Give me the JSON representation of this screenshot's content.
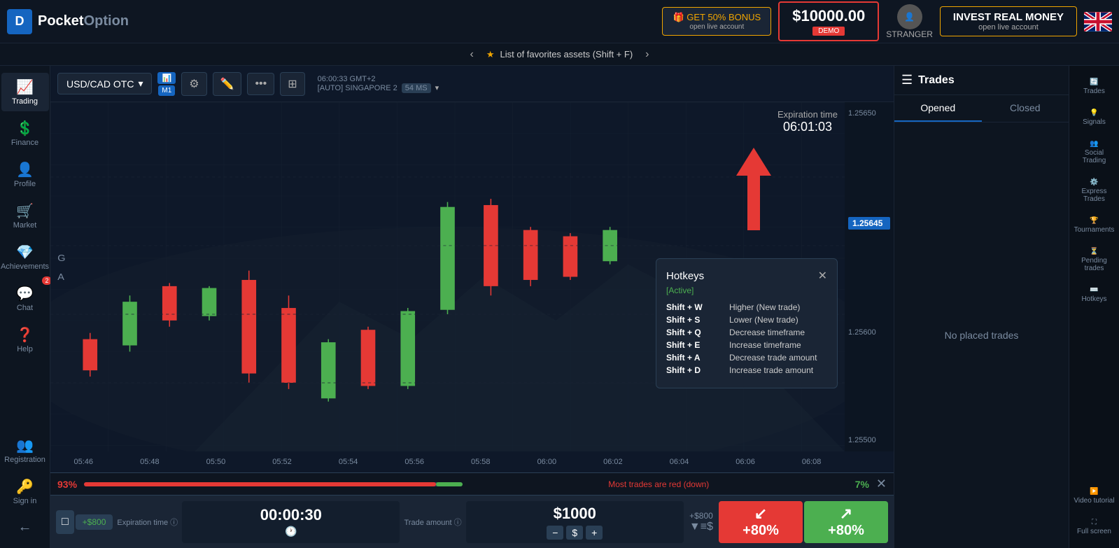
{
  "header": {
    "logo_text": "Pocket",
    "logo_text2": "Option",
    "bonus_label": "GET 50% BONUS",
    "bonus_sub": "open live account",
    "balance": "$10000.00",
    "balance_mode": "DEMO",
    "user_label": "STRANGER",
    "invest_title": "INVEST REAL MONEY",
    "invest_sub": "open live account"
  },
  "fav_bar": {
    "text": "List of favorites assets (Shift + F)"
  },
  "left_sidebar": {
    "items": [
      {
        "label": "Trading",
        "icon": "📈"
      },
      {
        "label": "Finance",
        "icon": "💲"
      },
      {
        "label": "Profile",
        "icon": "👤"
      },
      {
        "label": "Market",
        "icon": "🛒"
      },
      {
        "label": "Achievements",
        "icon": "💎"
      },
      {
        "label": "Chat",
        "icon": "💬",
        "badge": "2"
      },
      {
        "label": "Help",
        "icon": "❓"
      }
    ],
    "bottom_items": [
      {
        "label": "Registration",
        "icon": "👥"
      },
      {
        "label": "Sign in",
        "icon": "🔑"
      },
      {
        "label": "",
        "icon": "←"
      }
    ]
  },
  "chart": {
    "asset": "USD/CAD OTC",
    "timeframe": "M1",
    "server_time": "06:00:33 GMT+2",
    "server_label": "[AUTO] SINGAPORE 2",
    "latency": "54 MS",
    "expiration_label": "Expiration time",
    "expiration_time": "06:01:03",
    "price_levels": [
      "1.25650",
      "1.25645",
      "1.25600",
      "1.25500"
    ],
    "current_price": "1.25645",
    "time_labels": [
      "05:46",
      "05:48",
      "05:50",
      "05:52",
      "05:54",
      "05:56",
      "05:58",
      "06:00",
      "06:02",
      "06:04",
      "06:06",
      "06:08"
    ]
  },
  "hotkeys": {
    "title": "Hotkeys",
    "status": "[Active]",
    "items": [
      {
        "key": "Shift + W",
        "action": "Higher (New trade)"
      },
      {
        "key": "Shift + S",
        "action": "Lower (New trade)"
      },
      {
        "key": "Shift + Q",
        "action": "Decrease timeframe"
      },
      {
        "key": "Shift + E",
        "action": "Increase timeframe"
      },
      {
        "key": "Shift + A",
        "action": "Decrease trade amount"
      },
      {
        "key": "Shift + D",
        "action": "Increase trade amount"
      }
    ]
  },
  "trade_panel": {
    "pct_red": "93%",
    "pct_green": "7%",
    "bar_label": "Most trades are red (down)",
    "amount_bonus": "+$800",
    "expiry_label": "Expiration time",
    "expiry_time": "00:00:30",
    "trade_amount_label": "Trade amount",
    "trade_amount": "$1000",
    "right_bonus": "+$800",
    "btn_down_pct": "+80%",
    "btn_up_pct": "+80%"
  },
  "trades_panel": {
    "title": "Trades",
    "tab_opened": "Opened",
    "tab_closed": "Closed",
    "no_trades_msg": "No placed trades"
  },
  "right_sidebar": {
    "items": [
      {
        "label": "Trades",
        "icon": "🔄"
      },
      {
        "label": "Signals",
        "icon": "💡"
      },
      {
        "label": "Social Trading",
        "icon": "👥"
      },
      {
        "label": "Express Trades",
        "icon": "⚙️"
      },
      {
        "label": "Tournaments",
        "icon": "🏆"
      },
      {
        "label": "Pending trades",
        "icon": "⏳"
      },
      {
        "label": "Hotkeys",
        "icon": "⌨️"
      },
      {
        "label": "Video tutorial",
        "icon": "▶️"
      },
      {
        "label": "Full screen",
        "icon": "⛶"
      }
    ]
  }
}
